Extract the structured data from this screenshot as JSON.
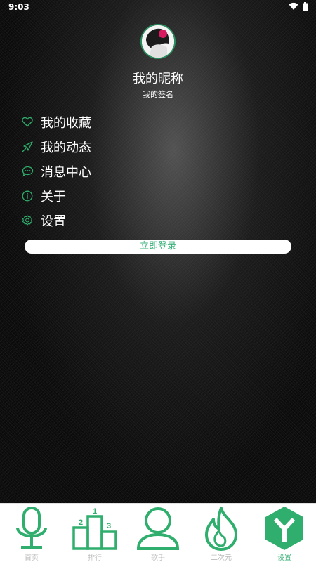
{
  "status_bar": {
    "time": "9:03"
  },
  "profile": {
    "nickname": "我的昵称",
    "signature": "我的签名"
  },
  "menu": {
    "items": [
      {
        "label": "我的收藏",
        "icon": "heart-icon"
      },
      {
        "label": "我的动态",
        "icon": "plane-icon"
      },
      {
        "label": "消息中心",
        "icon": "chat-icon"
      },
      {
        "label": "关于",
        "icon": "info-icon"
      },
      {
        "label": "设置",
        "icon": "gear-icon"
      }
    ]
  },
  "login_label": "立即登录",
  "bottom_nav": {
    "items": [
      {
        "label": "首页",
        "icon": "microphone-icon"
      },
      {
        "label": "排行",
        "icon": "podium-icon"
      },
      {
        "label": "歌手",
        "icon": "singer-icon"
      },
      {
        "label": "二次元",
        "icon": "flame-icon"
      },
      {
        "label": "设置",
        "icon": "settings-hex-icon",
        "active": true
      }
    ]
  },
  "colors": {
    "accent": "#3ab17a",
    "icon_green": "#2fae6d",
    "inactive_label": "#bdbdbd"
  }
}
